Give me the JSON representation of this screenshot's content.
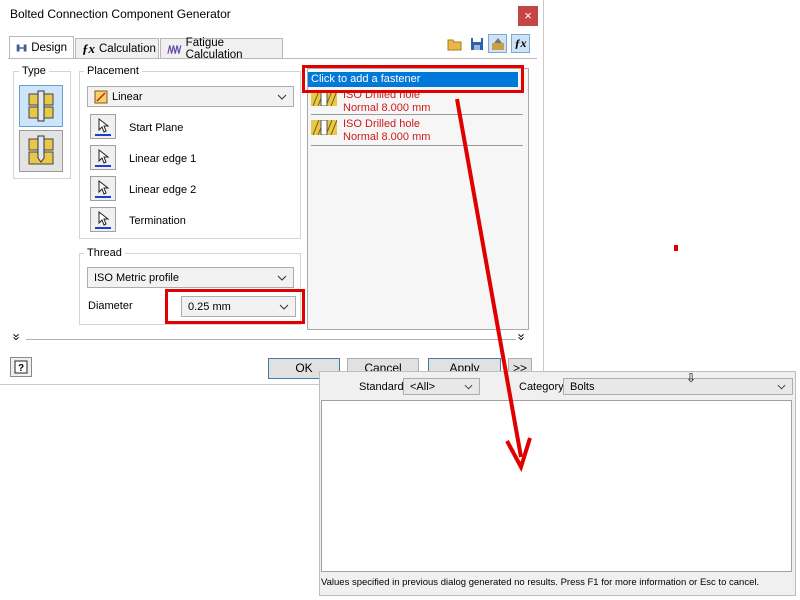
{
  "window": {
    "title": "Bolted Connection Component Generator",
    "close_glyph": "×"
  },
  "tabs": [
    {
      "label": "Design",
      "icon": "design-icon"
    },
    {
      "label": "Calculation",
      "icon": "fx-icon"
    },
    {
      "label": "Fatigue Calculation",
      "icon": "fatigue-icon"
    }
  ],
  "toolbar": {
    "icons": [
      "open-folder-icon",
      "save-icon",
      "options-icon",
      "fx-icon"
    ]
  },
  "type_group": {
    "label": "Type"
  },
  "placement": {
    "label": "Placement",
    "selected": "Linear",
    "selectors": [
      "Start Plane",
      "Linear edge 1",
      "Linear edge 2",
      "Termination"
    ]
  },
  "thread": {
    "label": "Thread",
    "profile": "ISO Metric profile",
    "diameter_label": "Diameter",
    "diameter_value": "0.25 mm"
  },
  "fasteners": {
    "add_text": "Click to add a fastener",
    "items": [
      {
        "name": "ISO Drilled hole",
        "detail": "Normal 8.000 mm"
      },
      {
        "name": "ISO Drilled hole",
        "detail": "Normal 8.000 mm"
      }
    ]
  },
  "expand_glyphs": {
    "left": "»",
    "right": "»"
  },
  "buttons": {
    "ok": "OK",
    "cancel": "Cancel",
    "apply": "Apply",
    "more": ">>"
  },
  "popup": {
    "standard_label": "Standard",
    "standard_value": "<All>",
    "category_label": "Category",
    "category_value": "Bolts",
    "status": "Values specified in previous dialog generated no results. Press F1 for more information or Esc to cancel."
  },
  "colors": {
    "highlight": "#e00000",
    "selection": "#0078d7",
    "fastener_text": "#cc1b1b"
  }
}
